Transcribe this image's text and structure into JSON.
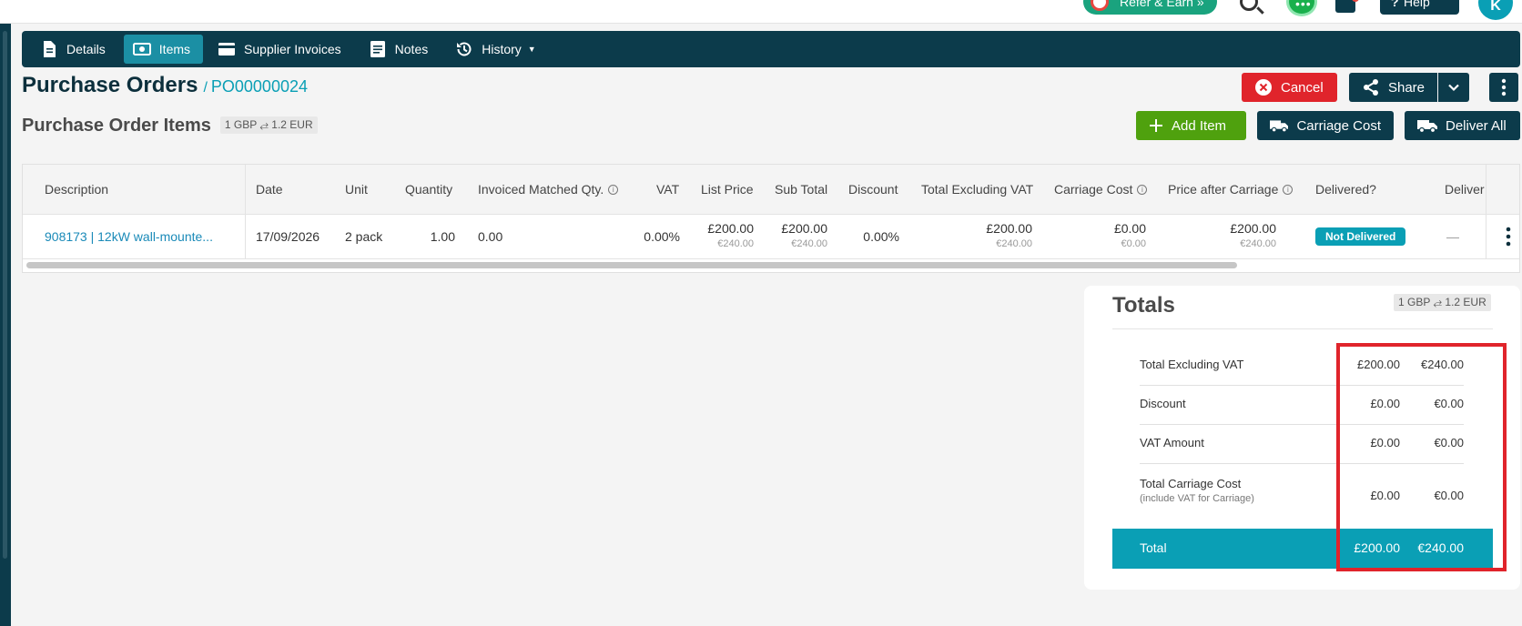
{
  "topbar": {
    "refer_label": "Refer & Earn »",
    "help_label": "Help",
    "avatar_initial": "K"
  },
  "tabs": [
    {
      "label": "Details",
      "icon": "document-icon",
      "active": false
    },
    {
      "label": "Items",
      "icon": "money-icon",
      "active": true
    },
    {
      "label": "Supplier Invoices",
      "icon": "card-icon",
      "active": false
    },
    {
      "label": "Notes",
      "icon": "notes-icon",
      "active": false
    },
    {
      "label": "History",
      "icon": "history-icon",
      "active": false
    }
  ],
  "page": {
    "title": "Purchase Orders",
    "separator": "/",
    "po_number": "PO00000024",
    "subtitle": "Purchase Order Items",
    "rate": "1 GBP ⥄ 1.2 EUR"
  },
  "actions": {
    "cancel": "Cancel",
    "share": "Share",
    "add_item": "Add Item",
    "carriage_cost": "Carriage Cost",
    "deliver_all": "Deliver All"
  },
  "table": {
    "headers": {
      "description": "Description",
      "date": "Date",
      "unit": "Unit",
      "quantity": "Quantity",
      "invoiced": "Invoiced Matched Qty.",
      "vat": "VAT",
      "list_price": "List Price",
      "sub_total": "Sub Total",
      "discount": "Discount",
      "total_ex_vat": "Total Excluding VAT",
      "carriage_cost": "Carriage Cost",
      "price_after_carriage": "Price after Carriage",
      "delivered": "Delivered?",
      "delivery": "Deliver"
    },
    "rows": [
      {
        "description": "908173 | 12kW wall-mounte...",
        "date": "17/09/2026",
        "unit": "2 pack",
        "quantity": "1.00",
        "invoiced": "0.00",
        "vat": "0.00%",
        "list_price": "£200.00",
        "list_price_eur": "€240.00",
        "sub_total": "£200.00",
        "sub_total_eur": "€240.00",
        "discount": "0.00%",
        "total_ex_vat": "£200.00",
        "total_ex_vat_eur": "€240.00",
        "carriage_cost": "£0.00",
        "carriage_cost_eur": "€0.00",
        "price_after_carriage": "£200.00",
        "price_after_carriage_eur": "€240.00",
        "delivered": "Not Delivered",
        "delivery": "—"
      }
    ]
  },
  "totals": {
    "title": "Totals",
    "rate": "1 GBP ⥄ 1.2 EUR",
    "rows": [
      {
        "label": "Total Excluding VAT",
        "gbp": "£200.00",
        "eur": "€240.00"
      },
      {
        "label": "Discount",
        "gbp": "£0.00",
        "eur": "€0.00"
      },
      {
        "label": "VAT Amount",
        "gbp": "£0.00",
        "eur": "€0.00"
      },
      {
        "label": "Total Carriage Cost",
        "note": "(include VAT for Carriage)",
        "gbp": "£0.00",
        "eur": "€0.00"
      }
    ],
    "total": {
      "label": "Total",
      "gbp": "£200.00",
      "eur": "€240.00"
    }
  },
  "colors": {
    "navy": "#0c3b4b",
    "teal": "#0a9fb5",
    "cancel_red": "#e0242b",
    "add_green": "#4fa10e",
    "highlight_red": "#e0242b"
  }
}
